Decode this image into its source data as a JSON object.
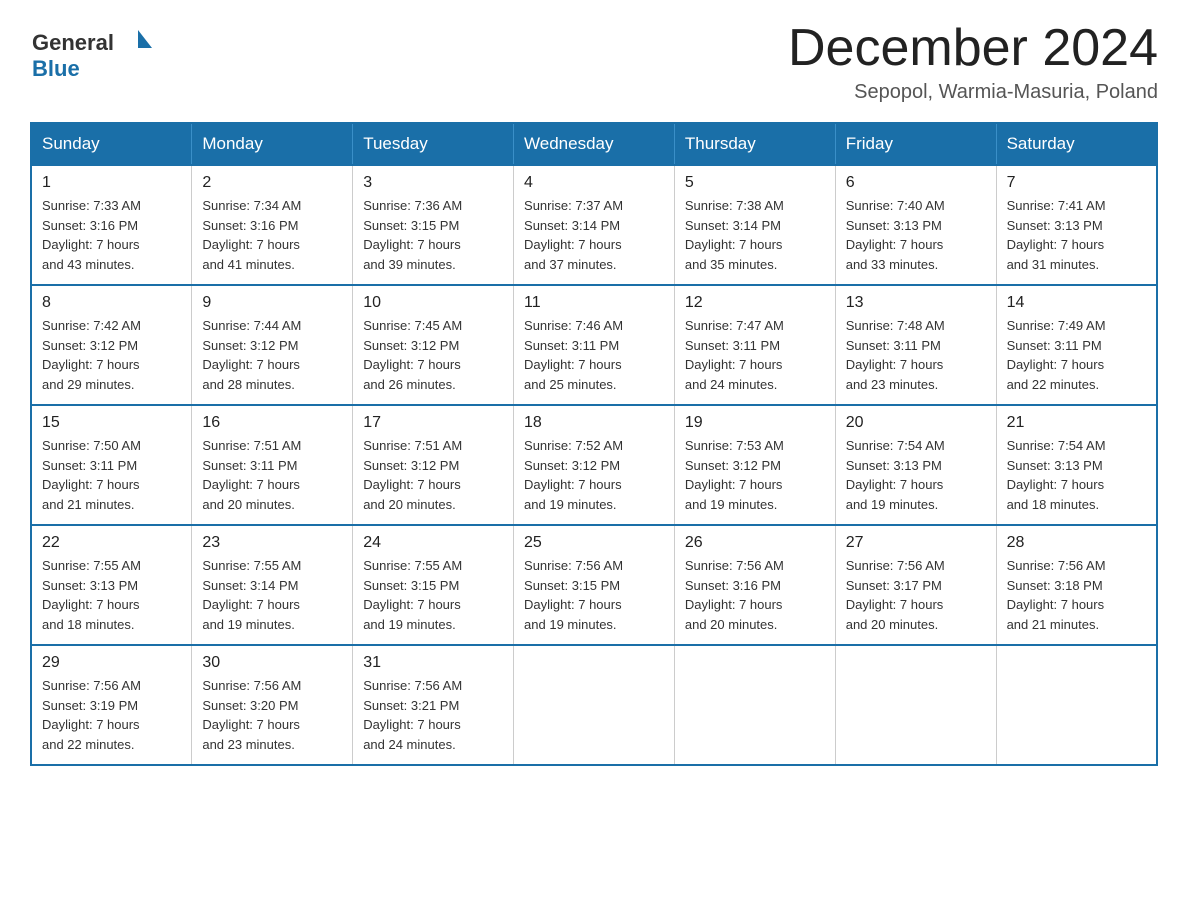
{
  "header": {
    "logo_general": "General",
    "logo_blue": "Blue",
    "month_title": "December 2024",
    "subtitle": "Sepopol, Warmia-Masuria, Poland"
  },
  "weekdays": [
    "Sunday",
    "Monday",
    "Tuesday",
    "Wednesday",
    "Thursday",
    "Friday",
    "Saturday"
  ],
  "weeks": [
    [
      {
        "day": "1",
        "sunrise": "7:33 AM",
        "sunset": "3:16 PM",
        "daylight": "7 hours and 43 minutes."
      },
      {
        "day": "2",
        "sunrise": "7:34 AM",
        "sunset": "3:16 PM",
        "daylight": "7 hours and 41 minutes."
      },
      {
        "day": "3",
        "sunrise": "7:36 AM",
        "sunset": "3:15 PM",
        "daylight": "7 hours and 39 minutes."
      },
      {
        "day": "4",
        "sunrise": "7:37 AM",
        "sunset": "3:14 PM",
        "daylight": "7 hours and 37 minutes."
      },
      {
        "day": "5",
        "sunrise": "7:38 AM",
        "sunset": "3:14 PM",
        "daylight": "7 hours and 35 minutes."
      },
      {
        "day": "6",
        "sunrise": "7:40 AM",
        "sunset": "3:13 PM",
        "daylight": "7 hours and 33 minutes."
      },
      {
        "day": "7",
        "sunrise": "7:41 AM",
        "sunset": "3:13 PM",
        "daylight": "7 hours and 31 minutes."
      }
    ],
    [
      {
        "day": "8",
        "sunrise": "7:42 AM",
        "sunset": "3:12 PM",
        "daylight": "7 hours and 29 minutes."
      },
      {
        "day": "9",
        "sunrise": "7:44 AM",
        "sunset": "3:12 PM",
        "daylight": "7 hours and 28 minutes."
      },
      {
        "day": "10",
        "sunrise": "7:45 AM",
        "sunset": "3:12 PM",
        "daylight": "7 hours and 26 minutes."
      },
      {
        "day": "11",
        "sunrise": "7:46 AM",
        "sunset": "3:11 PM",
        "daylight": "7 hours and 25 minutes."
      },
      {
        "day": "12",
        "sunrise": "7:47 AM",
        "sunset": "3:11 PM",
        "daylight": "7 hours and 24 minutes."
      },
      {
        "day": "13",
        "sunrise": "7:48 AM",
        "sunset": "3:11 PM",
        "daylight": "7 hours and 23 minutes."
      },
      {
        "day": "14",
        "sunrise": "7:49 AM",
        "sunset": "3:11 PM",
        "daylight": "7 hours and 22 minutes."
      }
    ],
    [
      {
        "day": "15",
        "sunrise": "7:50 AM",
        "sunset": "3:11 PM",
        "daylight": "7 hours and 21 minutes."
      },
      {
        "day": "16",
        "sunrise": "7:51 AM",
        "sunset": "3:11 PM",
        "daylight": "7 hours and 20 minutes."
      },
      {
        "day": "17",
        "sunrise": "7:51 AM",
        "sunset": "3:12 PM",
        "daylight": "7 hours and 20 minutes."
      },
      {
        "day": "18",
        "sunrise": "7:52 AM",
        "sunset": "3:12 PM",
        "daylight": "7 hours and 19 minutes."
      },
      {
        "day": "19",
        "sunrise": "7:53 AM",
        "sunset": "3:12 PM",
        "daylight": "7 hours and 19 minutes."
      },
      {
        "day": "20",
        "sunrise": "7:54 AM",
        "sunset": "3:13 PM",
        "daylight": "7 hours and 19 minutes."
      },
      {
        "day": "21",
        "sunrise": "7:54 AM",
        "sunset": "3:13 PM",
        "daylight": "7 hours and 18 minutes."
      }
    ],
    [
      {
        "day": "22",
        "sunrise": "7:55 AM",
        "sunset": "3:13 PM",
        "daylight": "7 hours and 18 minutes."
      },
      {
        "day": "23",
        "sunrise": "7:55 AM",
        "sunset": "3:14 PM",
        "daylight": "7 hours and 19 minutes."
      },
      {
        "day": "24",
        "sunrise": "7:55 AM",
        "sunset": "3:15 PM",
        "daylight": "7 hours and 19 minutes."
      },
      {
        "day": "25",
        "sunrise": "7:56 AM",
        "sunset": "3:15 PM",
        "daylight": "7 hours and 19 minutes."
      },
      {
        "day": "26",
        "sunrise": "7:56 AM",
        "sunset": "3:16 PM",
        "daylight": "7 hours and 20 minutes."
      },
      {
        "day": "27",
        "sunrise": "7:56 AM",
        "sunset": "3:17 PM",
        "daylight": "7 hours and 20 minutes."
      },
      {
        "day": "28",
        "sunrise": "7:56 AM",
        "sunset": "3:18 PM",
        "daylight": "7 hours and 21 minutes."
      }
    ],
    [
      {
        "day": "29",
        "sunrise": "7:56 AM",
        "sunset": "3:19 PM",
        "daylight": "7 hours and 22 minutes."
      },
      {
        "day": "30",
        "sunrise": "7:56 AM",
        "sunset": "3:20 PM",
        "daylight": "7 hours and 23 minutes."
      },
      {
        "day": "31",
        "sunrise": "7:56 AM",
        "sunset": "3:21 PM",
        "daylight": "7 hours and 24 minutes."
      },
      null,
      null,
      null,
      null
    ]
  ],
  "labels": {
    "sunrise_prefix": "Sunrise: ",
    "sunset_prefix": "Sunset: ",
    "daylight_prefix": "Daylight: "
  }
}
